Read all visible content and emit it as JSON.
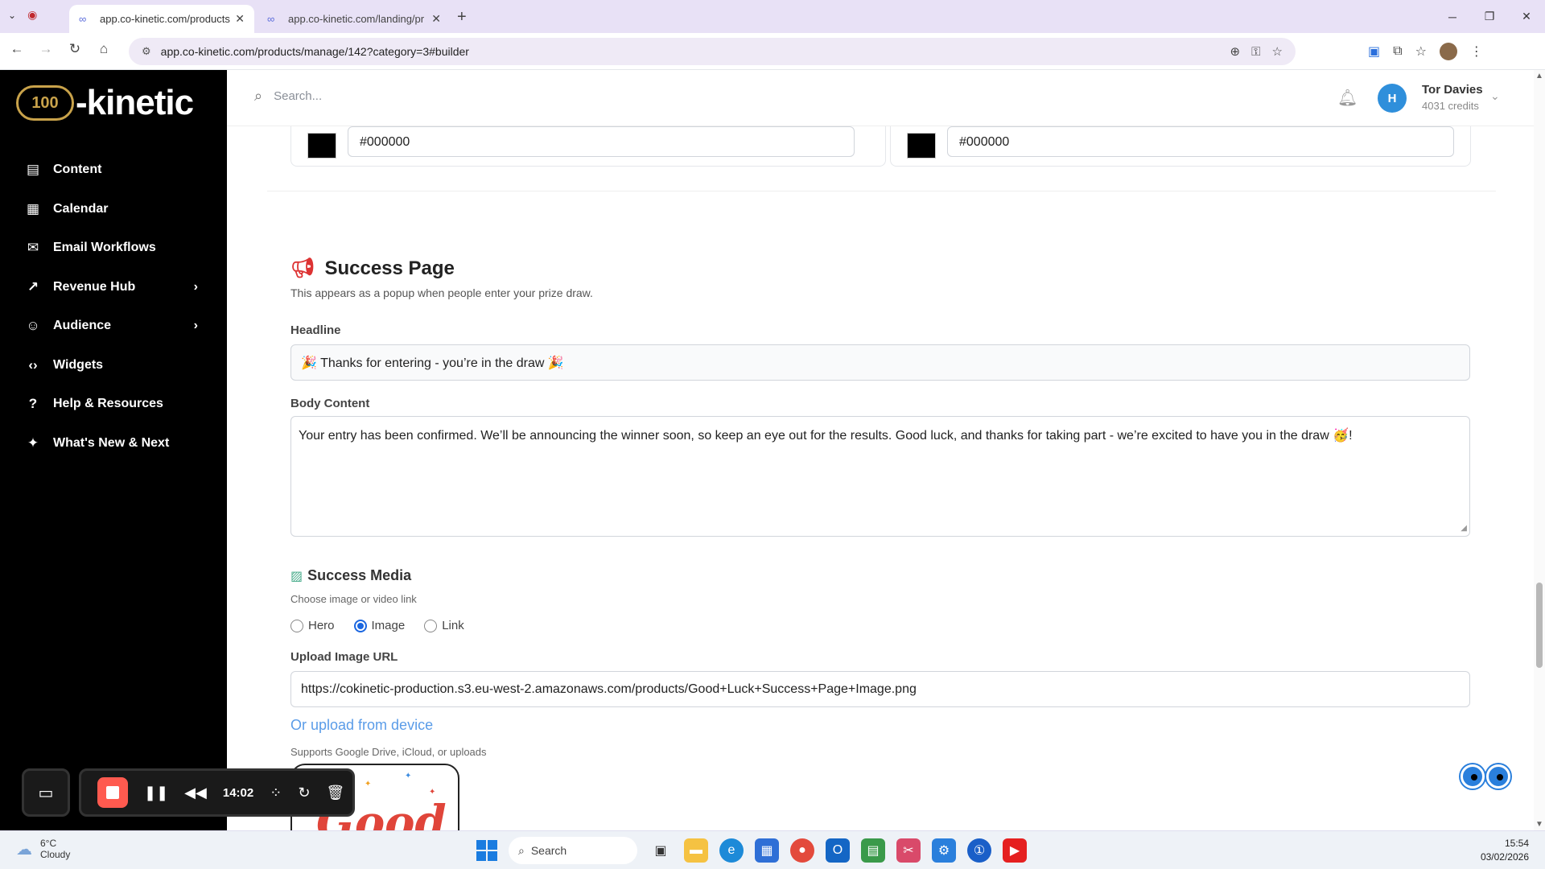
{
  "browser": {
    "tabs": [
      {
        "title": "app.co-kinetic.com/products/m",
        "active": true
      },
      {
        "title": "app.co-kinetic.com/landing/pr",
        "active": false
      }
    ],
    "url": "app.co-kinetic.com/products/manage/142?category=3#builder"
  },
  "app": {
    "logo_mark": "100",
    "logo_text": "-kinetic",
    "search_placeholder": "Search...",
    "user": {
      "initial": "H",
      "name": "Tor Davies",
      "credits": "4031 credits"
    }
  },
  "sidebar": {
    "items": [
      {
        "label": "Content",
        "icon": "document-icon"
      },
      {
        "label": "Calendar",
        "icon": "calendar-icon"
      },
      {
        "label": "Email Workflows",
        "icon": "mail-icon"
      },
      {
        "label": "Revenue Hub",
        "icon": "trend-icon",
        "expandable": true
      },
      {
        "label": "Audience",
        "icon": "users-icon",
        "expandable": true
      },
      {
        "label": "Widgets",
        "icon": "code-icon"
      },
      {
        "label": "Help & Resources",
        "icon": "help-icon"
      },
      {
        "label": "What's New & Next",
        "icon": "sparkle-icon"
      }
    ]
  },
  "colors": {
    "left_hex": "#000000",
    "right_hex": "#000000"
  },
  "success_page": {
    "title": "Success Page",
    "subtitle": "This appears as a popup when people enter your prize draw.",
    "headline_label": "Headline",
    "headline_value": "🎉 Thanks for entering - you’re in the draw 🎉",
    "body_label": "Body Content",
    "body_value": "Your entry has been confirmed. We’ll be announcing the winner soon, so keep an eye out for the results. Good luck, and thanks for taking part - we’re excited to have you in the draw 🥳!"
  },
  "success_media": {
    "title": "Success Media",
    "subtitle": "Choose image or video link",
    "options": [
      {
        "label": "Hero",
        "selected": false
      },
      {
        "label": "Image",
        "selected": true
      },
      {
        "label": "Link",
        "selected": false
      }
    ],
    "url_label": "Upload Image URL",
    "url_value": "https://cokinetic-production.s3.eu-west-2.amazonaws.com/products/Good+Luck+Success+Page+Image.png",
    "upload_link": "Or upload from device",
    "upload_sub": "Supports Google Drive, iCloud, or uploads",
    "preview_text": "Good"
  },
  "recorder": {
    "time": "14:02"
  },
  "taskbar": {
    "temp": "6°C",
    "condition": "Cloudy",
    "search": "Search",
    "time": "15:54",
    "date": "03/02/2026"
  }
}
